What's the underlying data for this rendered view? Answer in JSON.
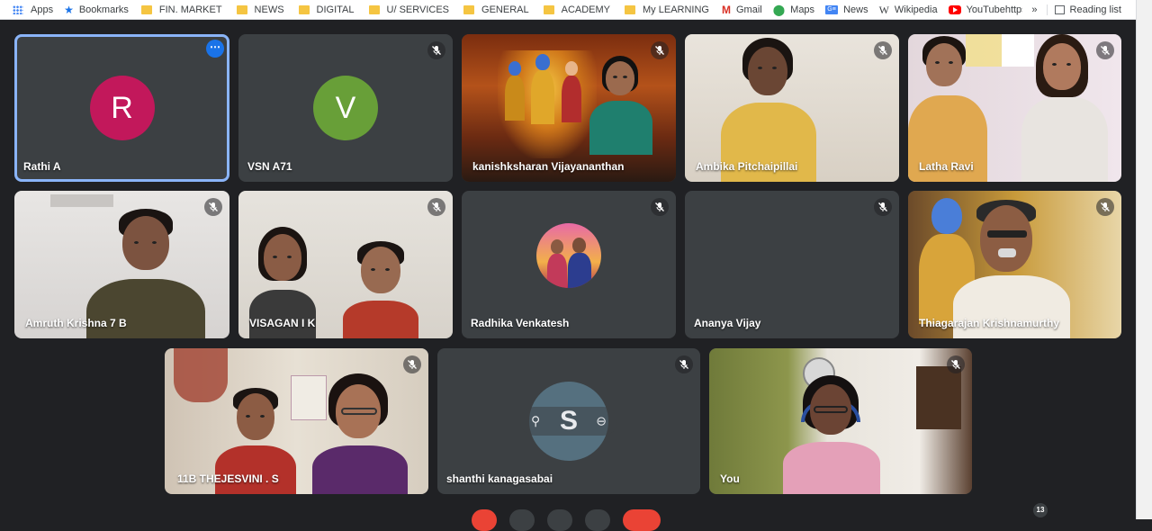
{
  "bookmarks": {
    "items": [
      {
        "label": "Apps",
        "icon": "apps-grid-icon"
      },
      {
        "label": "Bookmarks",
        "icon": "star-icon"
      },
      {
        "label": "FIN. MARKET",
        "icon": "folder-icon"
      },
      {
        "label": "NEWS",
        "icon": "folder-icon"
      },
      {
        "label": "DIGITAL",
        "icon": "folder-icon"
      },
      {
        "label": "U/ SERVICES",
        "icon": "folder-icon"
      },
      {
        "label": "GENERAL",
        "icon": "folder-icon"
      },
      {
        "label": "ACADEMY",
        "icon": "folder-icon"
      },
      {
        "label": "My LEARNING",
        "icon": "folder-icon"
      },
      {
        "label": "Gmail",
        "icon": "gmail-icon"
      },
      {
        "label": "Maps",
        "icon": "maps-icon"
      },
      {
        "label": "News",
        "icon": "news-icon"
      },
      {
        "label": "Wikipedia",
        "icon": "wikipedia-icon"
      },
      {
        "label": "YouTubehttps://ww...",
        "icon": "youtube-icon"
      }
    ],
    "overflow_label": "»",
    "reading_list": "Reading list"
  },
  "participants": [
    {
      "name": "Rathi A",
      "type": "avatar",
      "initial": "R",
      "color": "#c2185b",
      "pinned": true
    },
    {
      "name": "VSN A71",
      "type": "avatar",
      "initial": "V",
      "color": "#689f38",
      "muted": true
    },
    {
      "name": "kanishksharan Vijayananthan",
      "type": "video",
      "muted": true
    },
    {
      "name": "Ambika Pitchaipillai",
      "type": "video",
      "muted": true
    },
    {
      "name": "Latha Ravi",
      "type": "video",
      "muted": true
    },
    {
      "name": "Amruth Krishna 7 B",
      "type": "video",
      "muted": true
    },
    {
      "name": "VISAGAN I K",
      "type": "video",
      "muted": true
    },
    {
      "name": "Radhika Venkatesh",
      "type": "photo-avatar",
      "muted": true
    },
    {
      "name": "Ananya Vijay",
      "type": "blank",
      "muted": true
    },
    {
      "name": "Thiagarajan Krishnamurthy",
      "type": "video",
      "muted": true
    },
    {
      "name": "11B THEJESVINI . S",
      "type": "video",
      "muted": true
    },
    {
      "name": "shanthi kanagasabai",
      "type": "avatar",
      "initial": "S",
      "muted": true
    },
    {
      "name": "You",
      "type": "video",
      "muted": true
    }
  ],
  "participant_count": "13",
  "colors": {
    "stage": "#202124",
    "tile": "#3c4043",
    "accent": "#8ab4f8",
    "end_call": "#ea4335"
  }
}
